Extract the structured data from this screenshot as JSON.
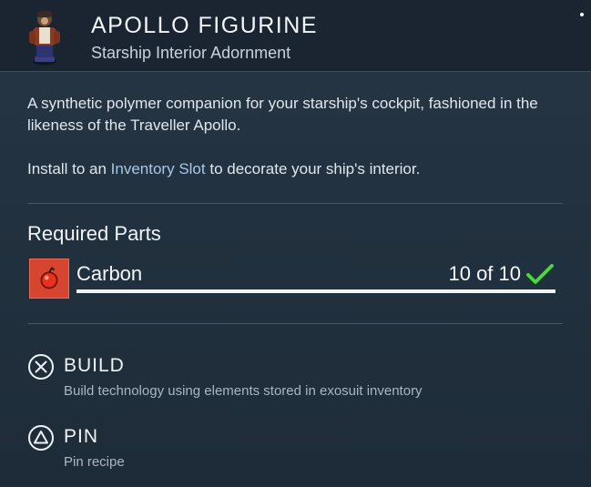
{
  "header": {
    "title": "APOLLO FIGURINE",
    "subtitle": "Starship Interior Adornment",
    "thumbnail_icon": "apollo-figurine-icon"
  },
  "description": {
    "line1": "A synthetic polymer companion for your starship's cockpit, fashioned in the likeness of the Traveller Apollo.",
    "line2_prefix": "Install to an ",
    "line2_highlight": "Inventory Slot",
    "line2_suffix": " to decorate your ship's interior."
  },
  "required_parts": {
    "title": "Required Parts",
    "items": [
      {
        "name": "Carbon",
        "count": "10 of 10",
        "progress": 1.0,
        "icon": "carbon-icon",
        "status_icon": "checkmark-icon"
      }
    ]
  },
  "actions": [
    {
      "label": "BUILD",
      "hint": "Build technology using elements stored in exosuit inventory",
      "icon": "cross-button-icon"
    },
    {
      "label": "PIN",
      "hint": "Pin recipe",
      "icon": "triangle-button-icon"
    }
  ],
  "colors": {
    "panel_bg": "#22313f",
    "header_bg": "#1a2531",
    "highlight": "#a8c6e6",
    "carbon": "#d6452f",
    "check": "#4fd14a"
  }
}
